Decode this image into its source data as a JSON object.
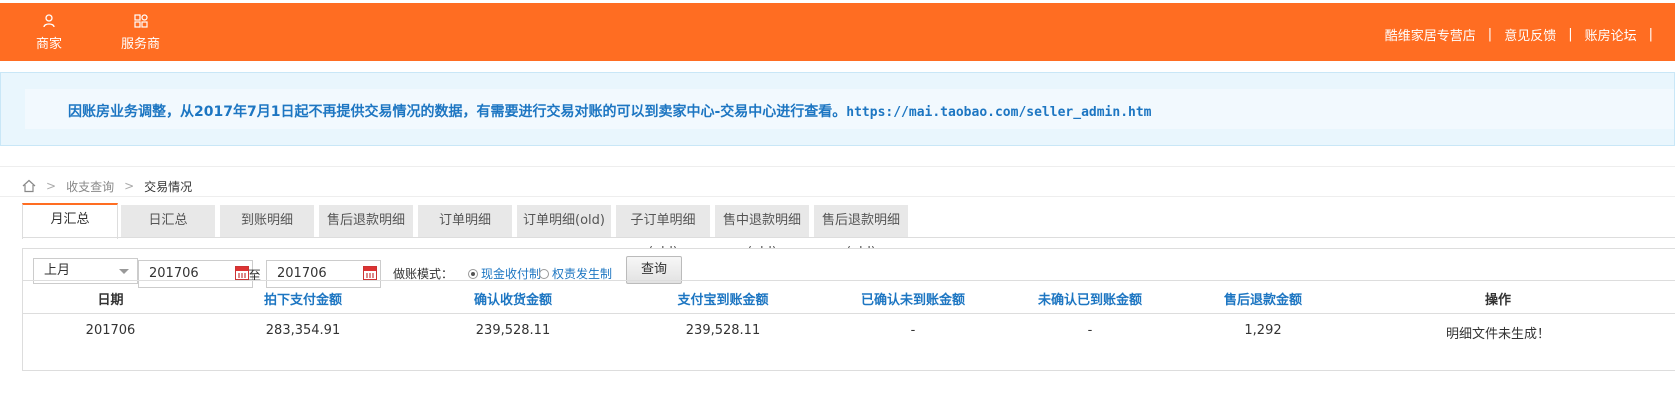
{
  "topnav": {
    "merchant": "商家",
    "service": "服务商"
  },
  "toplinks": {
    "store": "酷维家居专营店",
    "feedback": "意见反馈",
    "forum": "账房论坛",
    "sep": "|"
  },
  "notice": {
    "text": "因账房业务调整，从2017年7月1日起不再提供交易情况的数据，有需要进行交易对账的可以到卖家中心-交易中心进行查看。",
    "url": "https://mai.taobao.com/seller_admin.htm"
  },
  "breadcrumb": {
    "chev": ">",
    "level1": "收支查询",
    "current": "交易情况"
  },
  "tabs": [
    "月汇总",
    "日汇总",
    "到账明细",
    "售后退款明细",
    "订单明细",
    "订单明细(old)",
    "子订单明细(old)",
    "售中退款明细(old)",
    "售后退款明细(old)"
  ],
  "filter": {
    "period": "上月",
    "start": "201706",
    "to": "至",
    "end": "201706",
    "mode_label": "做账模式：",
    "mode_cash": "现金收付制",
    "mode_accrual": "权责发生制",
    "query": "查询"
  },
  "table": {
    "headers": [
      "日期",
      "拍下支付金额",
      "确认收货金额",
      "支付宝到账金额",
      "已确认未到账金额",
      "未确认已到账金额",
      "售后退款金额",
      "操作"
    ],
    "rows": [
      [
        "201706",
        "283,354.91",
        "239,528.11",
        "239,528.11",
        "-",
        "-",
        "1,292",
        "明细文件未生成！"
      ]
    ]
  },
  "colors": {
    "brand": "#ff6d22",
    "link": "#1d76c2"
  }
}
